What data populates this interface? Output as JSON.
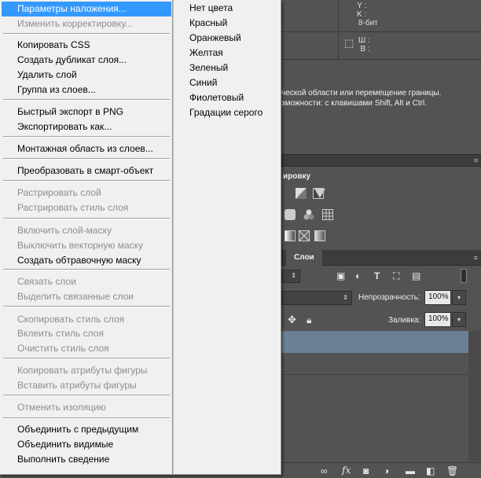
{
  "info_panel": {
    "y_label": "Y :",
    "k_label": "K :",
    "bit_depth": "8-бит",
    "w_label": "Ш :",
    "h_label": "В :",
    "help_line_1": "ческой области или перемещение границы.",
    "help_line_2": "зможности: с клавишами Shift, Alt и Ctrl."
  },
  "adjustments_panel": {
    "title": "ировку"
  },
  "layers_panel": {
    "tab_label": "Слои",
    "opacity_label": "Непрозрачность:",
    "opacity_value": "100%",
    "fill_label": "Заливка:",
    "fill_value": "100%",
    "dropdown_arrow": "▾",
    "bottom_icons": [
      "link-icon",
      "fx-icon",
      "mask-icon",
      "adjustment-icon",
      "folder-icon",
      "new-layer-icon",
      "trash-icon"
    ],
    "fx_text": "fx"
  },
  "context_menu": {
    "items": [
      {
        "label": "Параметры наложения...",
        "state": "highlighted"
      },
      {
        "label": "Изменить корректировку...",
        "state": "disabled"
      },
      {
        "label": "Копировать CSS",
        "state": "enabled"
      },
      {
        "label": "Создать дубликат слоя...",
        "state": "enabled"
      },
      {
        "label": "Удалить слой",
        "state": "enabled"
      },
      {
        "label": "Группа из слоев...",
        "state": "enabled"
      },
      {
        "label": "Быстрый экспорт в PNG",
        "state": "enabled"
      },
      {
        "label": "Экспортировать как...",
        "state": "enabled"
      },
      {
        "label": "Монтажная область из слоев...",
        "state": "enabled"
      },
      {
        "label": "Преобразовать в смарт-объект",
        "state": "enabled"
      },
      {
        "label": "Растрировать слой",
        "state": "disabled"
      },
      {
        "label": "Растрировать стиль слоя",
        "state": "disabled"
      },
      {
        "label": "Включить слой-маску",
        "state": "disabled"
      },
      {
        "label": "Выключить векторную маску",
        "state": "disabled"
      },
      {
        "label": "Создать обтравочную маску",
        "state": "enabled"
      },
      {
        "label": "Связать слои",
        "state": "disabled"
      },
      {
        "label": "Выделить связанные слои",
        "state": "disabled"
      },
      {
        "label": "Скопировать стиль слоя",
        "state": "disabled"
      },
      {
        "label": "Вклеить стиль слоя",
        "state": "disabled"
      },
      {
        "label": "Очистить стиль слоя",
        "state": "disabled"
      },
      {
        "label": "Копировать атрибуты фигуры",
        "state": "disabled"
      },
      {
        "label": "Вставить атрибуты фигуры",
        "state": "disabled"
      },
      {
        "label": "Отменить изоляцию",
        "state": "disabled"
      },
      {
        "label": "Объединить с предыдущим",
        "state": "enabled"
      },
      {
        "label": "Объединить видимые",
        "state": "enabled"
      },
      {
        "label": "Выполнить сведение",
        "state": "enabled"
      }
    ]
  },
  "color_submenu": {
    "items": [
      {
        "label": "Нет цвета"
      },
      {
        "label": "Красный"
      },
      {
        "label": "Оранжевый"
      },
      {
        "label": "Желтая"
      },
      {
        "label": "Зеленый"
      },
      {
        "label": "Синий"
      },
      {
        "label": "Фиолетовый"
      },
      {
        "label": "Градации серого"
      }
    ]
  },
  "colors": {
    "highlight": "#3399ff",
    "menu_bg": "#f0f0f0",
    "panel_bg": "#535353",
    "selected_layer": "#6d7f95"
  }
}
